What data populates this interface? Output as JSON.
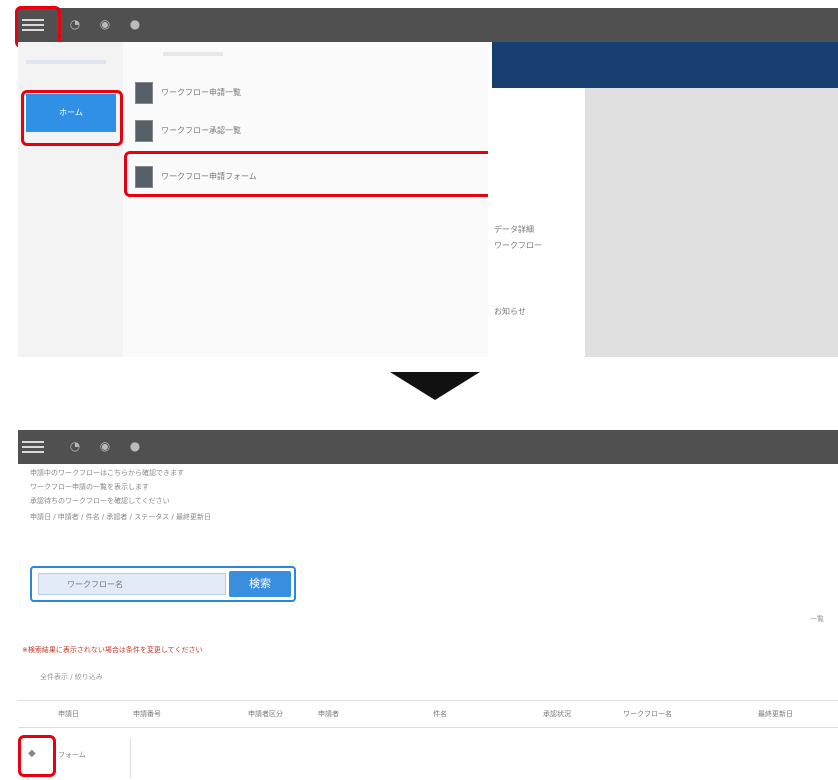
{
  "top_screenshot": {
    "toolbar": {
      "icons": [
        "hamburger-icon",
        "chat-icon",
        "bell-icon",
        "settings-icon"
      ]
    },
    "left_nav": {
      "active_item_label": "ホーム"
    },
    "menu_items": [
      {
        "label": "ワークフロー申請一覧"
      },
      {
        "label": "ワークフロー承認一覧"
      },
      {
        "label": "ワークフロー申請フォーム"
      }
    ],
    "side_text": [
      "データ詳細",
      "ワークフロー",
      "お知らせ"
    ]
  },
  "bottom_screenshot": {
    "info_lines": [
      "申請中のワークフローはこちらから確認できます",
      "ワークフロー申請の一覧を表示します",
      "承認待ちのワークフローを確認してください",
      "申請日 / 申請者 / 件名 / 承認者 / ステータス / 最終更新日"
    ],
    "search": {
      "placeholder": "ワークフロー名",
      "button_label": "検索"
    },
    "right_label": "一覧",
    "red_note": "※検索結果に表示されない場合は条件を変更してください",
    "sub_note": "全件表示 / 絞り込み",
    "columns": [
      "申請日",
      "申請番号",
      "申請者区分",
      "申請者",
      "件名",
      "承認状況",
      "ワークフロー名",
      "最終更新日"
    ],
    "row_label": "フォーム",
    "highlight_colors": {
      "annotation": "#e8000f",
      "accent": "#3a8ee0",
      "header": "#173f70"
    }
  }
}
